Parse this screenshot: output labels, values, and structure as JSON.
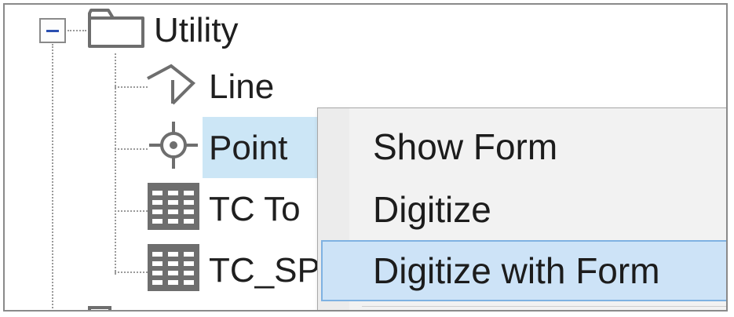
{
  "tree": {
    "root": {
      "label": "Utility",
      "expanded": true,
      "icon": "folder-icon"
    },
    "children": [
      {
        "label": "Line",
        "icon": "line-feature-icon",
        "selected": false
      },
      {
        "label": "Point",
        "icon": "point-feature-icon",
        "selected": true
      },
      {
        "label": "TC To",
        "icon": "table-icon",
        "selected": false
      },
      {
        "label": "TC_SP",
        "icon": "table-icon",
        "selected": false
      }
    ]
  },
  "context_menu": {
    "items": [
      {
        "label": "Show Form",
        "highlighted": false
      },
      {
        "label": "Digitize",
        "highlighted": false
      },
      {
        "label": "Digitize with Form",
        "highlighted": true
      }
    ]
  },
  "colors": {
    "selection": "#cce6f6",
    "menu_highlight": "#cde3f7",
    "menu_highlight_border": "#7fb2e2",
    "menu_background": "#f2f2f2",
    "icon_stroke": "#6e6e6e",
    "expander_minus": "#2a4fb0"
  }
}
